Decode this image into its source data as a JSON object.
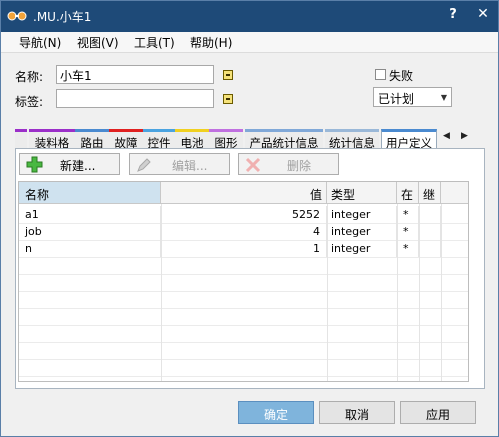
{
  "window": {
    "title": ".MU.小车1",
    "help": "?",
    "close": "✕"
  },
  "menu": [
    {
      "label": "导航(N)"
    },
    {
      "label": "视图(V)"
    },
    {
      "label": "工具(T)"
    },
    {
      "label": "帮助(H)"
    }
  ],
  "form": {
    "name_label": "名称:",
    "name_value": "小车1",
    "label_label": "标签:",
    "label_value": "",
    "failed_label": "失败",
    "failed_checked": false,
    "status_value": "已计划"
  },
  "tabs": [
    {
      "label": "装料格",
      "accent": "#9b2fc9"
    },
    {
      "label": "路由",
      "accent": "#4a8ad0"
    },
    {
      "label": "故障",
      "accent": "#e02020"
    },
    {
      "label": "控件",
      "accent": "#4aa3e0"
    },
    {
      "label": "电池",
      "accent": "#f0d020"
    },
    {
      "label": "图形",
      "accent": "#c070e0"
    },
    {
      "label": "产品统计信息",
      "accent": "#80a8d8"
    },
    {
      "label": "统计信息",
      "accent": "#9ab8d8"
    },
    {
      "label": "用户定义",
      "accent": "#4a8ad0",
      "active": true
    }
  ],
  "toolbar": {
    "new_label": "新建...",
    "edit_label": "编辑...",
    "delete_label": "删除"
  },
  "grid": {
    "headers": {
      "name": "名称",
      "value": "值",
      "type": "类型",
      "in": "在",
      "inherit": "继"
    },
    "rows": [
      {
        "name": "a1",
        "value": "5252",
        "type": "integer",
        "in": "*",
        "inherit": ""
      },
      {
        "name": "job",
        "value": "4",
        "type": "integer",
        "in": "*",
        "inherit": ""
      },
      {
        "name": "n",
        "value": "1",
        "type": "integer",
        "in": "*",
        "inherit": ""
      }
    ]
  },
  "buttons": {
    "ok": "确定",
    "cancel": "取消",
    "apply": "应用"
  }
}
